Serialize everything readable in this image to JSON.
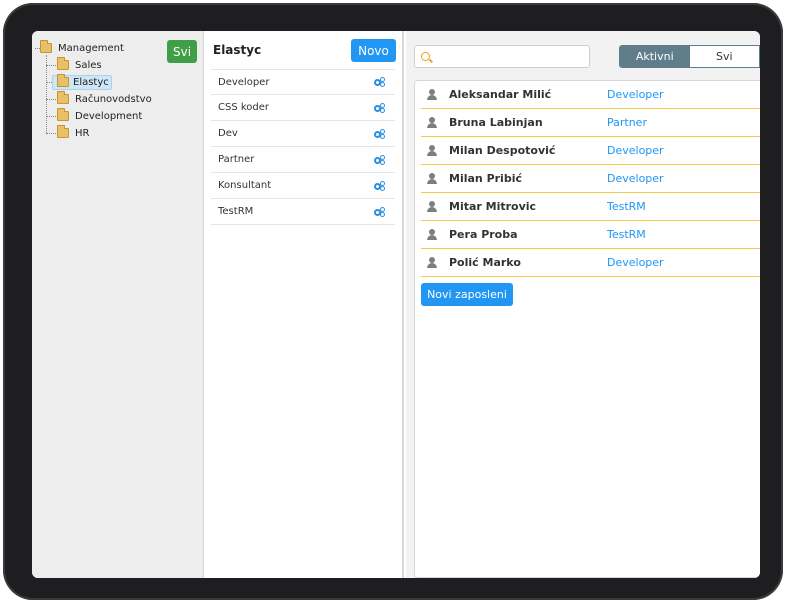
{
  "tree": {
    "all_button": "Svi",
    "root": "Management",
    "children": [
      "Sales",
      "Elastyc",
      "Računovodstvo",
      "Development",
      "HR"
    ],
    "selected": "Elastyc"
  },
  "roles": {
    "title": "Elastyc",
    "new_button": "Novo",
    "items": [
      "Developer",
      "CSS koder",
      "Dev",
      "Partner",
      "Konsultant",
      "TestRM"
    ]
  },
  "employees": {
    "search_placeholder": "",
    "filter": {
      "active_label": "Aktivni",
      "all_label": "Svi",
      "selected": "Aktivni"
    },
    "rows": [
      {
        "name": "Aleksandar Milić",
        "role": "Developer"
      },
      {
        "name": "Bruna Labinjan",
        "role": "Partner"
      },
      {
        "name": "Milan Despotović",
        "role": "Developer"
      },
      {
        "name": "Milan Pribić",
        "role": "Developer"
      },
      {
        "name": "Mitar Mitrovic",
        "role": "TestRM"
      },
      {
        "name": "Pera Proba",
        "role": "TestRM"
      },
      {
        "name": "Polić Marko",
        "role": "Developer"
      }
    ],
    "new_button": "Novi zaposleni"
  },
  "colors": {
    "green": "#3f9f47",
    "blue": "#2196f3",
    "slate": "#607d8b",
    "row_divider": "#f2c94c"
  }
}
